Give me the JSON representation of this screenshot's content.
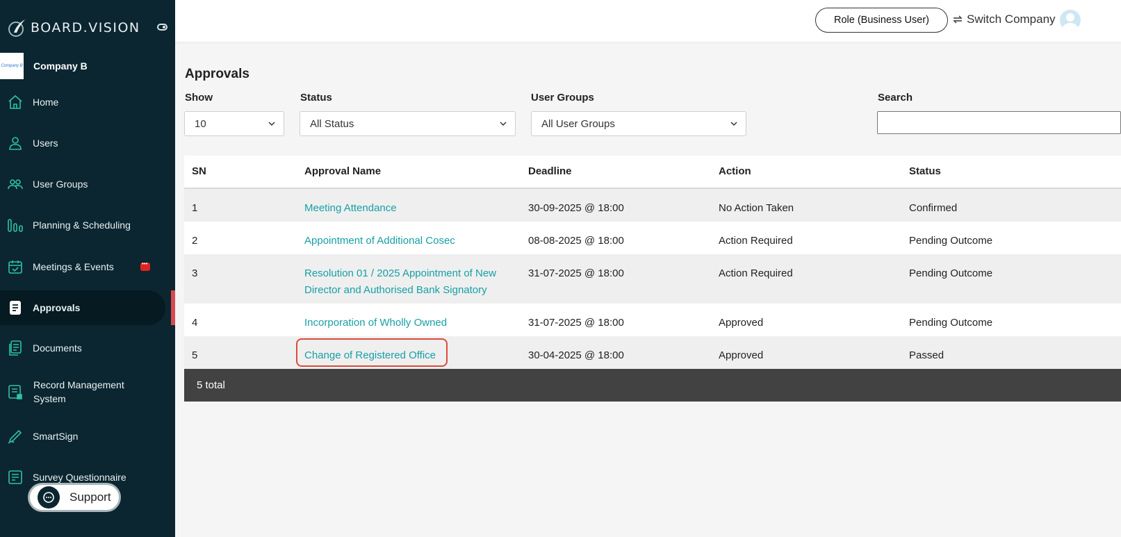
{
  "brand": {
    "name": "BOARD.VISION"
  },
  "company": {
    "name": "Company B",
    "logo_text": "Company B"
  },
  "sidebar": {
    "items": [
      {
        "label": "Home",
        "icon": "home-icon"
      },
      {
        "label": "Users",
        "icon": "user-icon"
      },
      {
        "label": "User Groups",
        "icon": "users-icon"
      },
      {
        "label": "Planning & Scheduling",
        "icon": "bar-chart-icon"
      },
      {
        "label": "Meetings & Events",
        "icon": "calendar-icon",
        "badge": true
      },
      {
        "label": "Approvals",
        "icon": "approval-doc-icon",
        "active": true
      },
      {
        "label": "Documents",
        "icon": "documents-icon"
      },
      {
        "label": "Record Management System",
        "icon": "record-icon"
      },
      {
        "label": "SmartSign",
        "icon": "pen-icon"
      },
      {
        "label": "Survey Questionnaire",
        "icon": "checklist-icon"
      }
    ],
    "accent": "#d84a4e"
  },
  "support": {
    "label": "Support"
  },
  "header": {
    "role_label": "Role (Business User)",
    "switch_label": "Switch Company"
  },
  "main": {
    "title": "Approvals",
    "filters": {
      "show_label": "Show",
      "show_value": "10",
      "status_label": "Status",
      "status_value": "All Status",
      "groups_label": "User Groups",
      "groups_value": "All User Groups",
      "search_label": "Search"
    },
    "table": {
      "headers": [
        "SN",
        "Approval Name",
        "Deadline",
        "Action",
        "Status"
      ],
      "rows": [
        {
          "sn": "1",
          "name": "Meeting Attendance",
          "deadline": "30-09-2025 @ 18:00",
          "action": "No Action Taken",
          "status": "Confirmed"
        },
        {
          "sn": "2",
          "name": "Appointment of Additional Cosec",
          "deadline": "08-08-2025 @ 18:00",
          "action": "Action Required",
          "status": "Pending Outcome"
        },
        {
          "sn": "3",
          "name": "Resolution 01 / 2025 Appointment of New Director and Authorised Bank Signatory",
          "deadline": "31-07-2025 @ 18:00",
          "action": "Action Required",
          "status": "Pending Outcome"
        },
        {
          "sn": "4",
          "name": "Incorporation of Wholly Owned",
          "deadline": "31-07-2025 @ 18:00",
          "action": "Approved",
          "status": "Pending Outcome"
        },
        {
          "sn": "5",
          "name": "Change of Registered Office",
          "deadline": "30-04-2025 @ 18:00",
          "action": "Approved",
          "status": "Passed"
        }
      ],
      "footer": "5 total"
    },
    "link_color": "#16a0a6",
    "highlight_color": "#d94b3c"
  }
}
